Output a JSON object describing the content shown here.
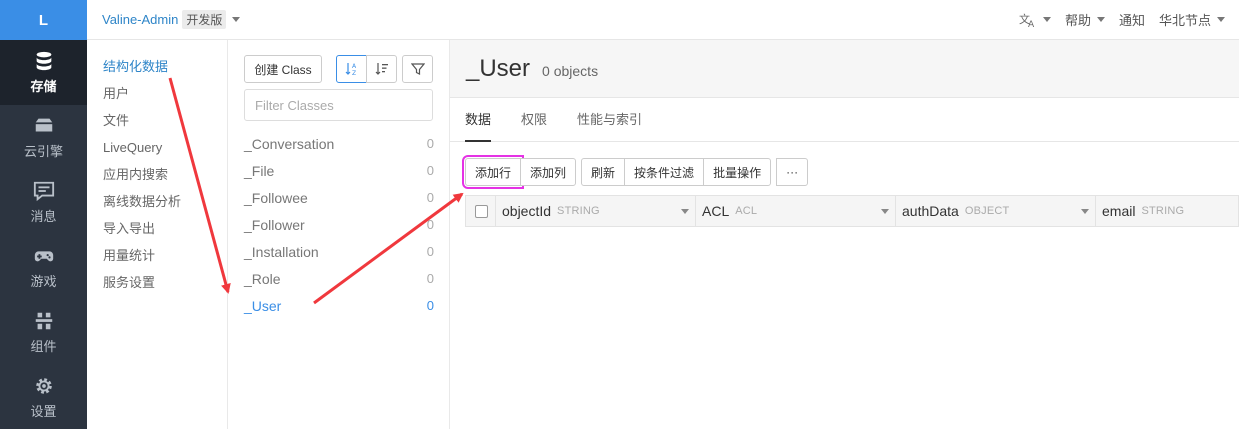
{
  "rail": {
    "logo": "L",
    "items": [
      {
        "label": "存储",
        "icon": "database-icon",
        "active": true
      },
      {
        "label": "云引擎",
        "icon": "cloud-engine-icon",
        "active": false
      },
      {
        "label": "消息",
        "icon": "message-icon",
        "active": false
      },
      {
        "label": "游戏",
        "icon": "gamepad-icon",
        "active": false
      },
      {
        "label": "组件",
        "icon": "components-icon",
        "active": false
      },
      {
        "label": "设置",
        "icon": "gear-icon",
        "active": false
      }
    ]
  },
  "topbar": {
    "app_name": "Valine-Admin",
    "badge": "开发版",
    "help": "帮助",
    "notify": "通知",
    "region": "华北节点"
  },
  "categories": [
    "结构化数据",
    "用户",
    "文件",
    "LiveQuery",
    "应用内搜索",
    "离线数据分析",
    "导入导出",
    "用量统计",
    "服务设置"
  ],
  "classpanel": {
    "create_label": "创建 Class",
    "filter_placeholder": "Filter Classes",
    "classes": [
      {
        "name": "_Conversation",
        "count": "0"
      },
      {
        "name": "_File",
        "count": "0"
      },
      {
        "name": "_Followee",
        "count": "0"
      },
      {
        "name": "_Follower",
        "count": "0"
      },
      {
        "name": "_Installation",
        "count": "0"
      },
      {
        "name": "_Role",
        "count": "0"
      },
      {
        "name": "_User",
        "count": "0"
      }
    ]
  },
  "main": {
    "title": "_User",
    "count": "0 objects",
    "tabs": [
      "数据",
      "权限",
      "性能与索引"
    ],
    "toolbar": {
      "add_row": "添加行",
      "add_col": "添加列",
      "refresh": "刷新",
      "filter": "按条件过滤",
      "batch": "批量操作",
      "more": "···"
    },
    "columns": [
      {
        "name": "objectId",
        "type": "STRING"
      },
      {
        "name": "ACL",
        "type": "ACL"
      },
      {
        "name": "authData",
        "type": "OBJECT"
      },
      {
        "name": "email",
        "type": "STRING"
      }
    ]
  },
  "colors": {
    "accent": "#3a8ee6",
    "rail_bg": "#2c3440",
    "highlight": "#e532e5",
    "annotation_arrow": "#f0383d"
  }
}
